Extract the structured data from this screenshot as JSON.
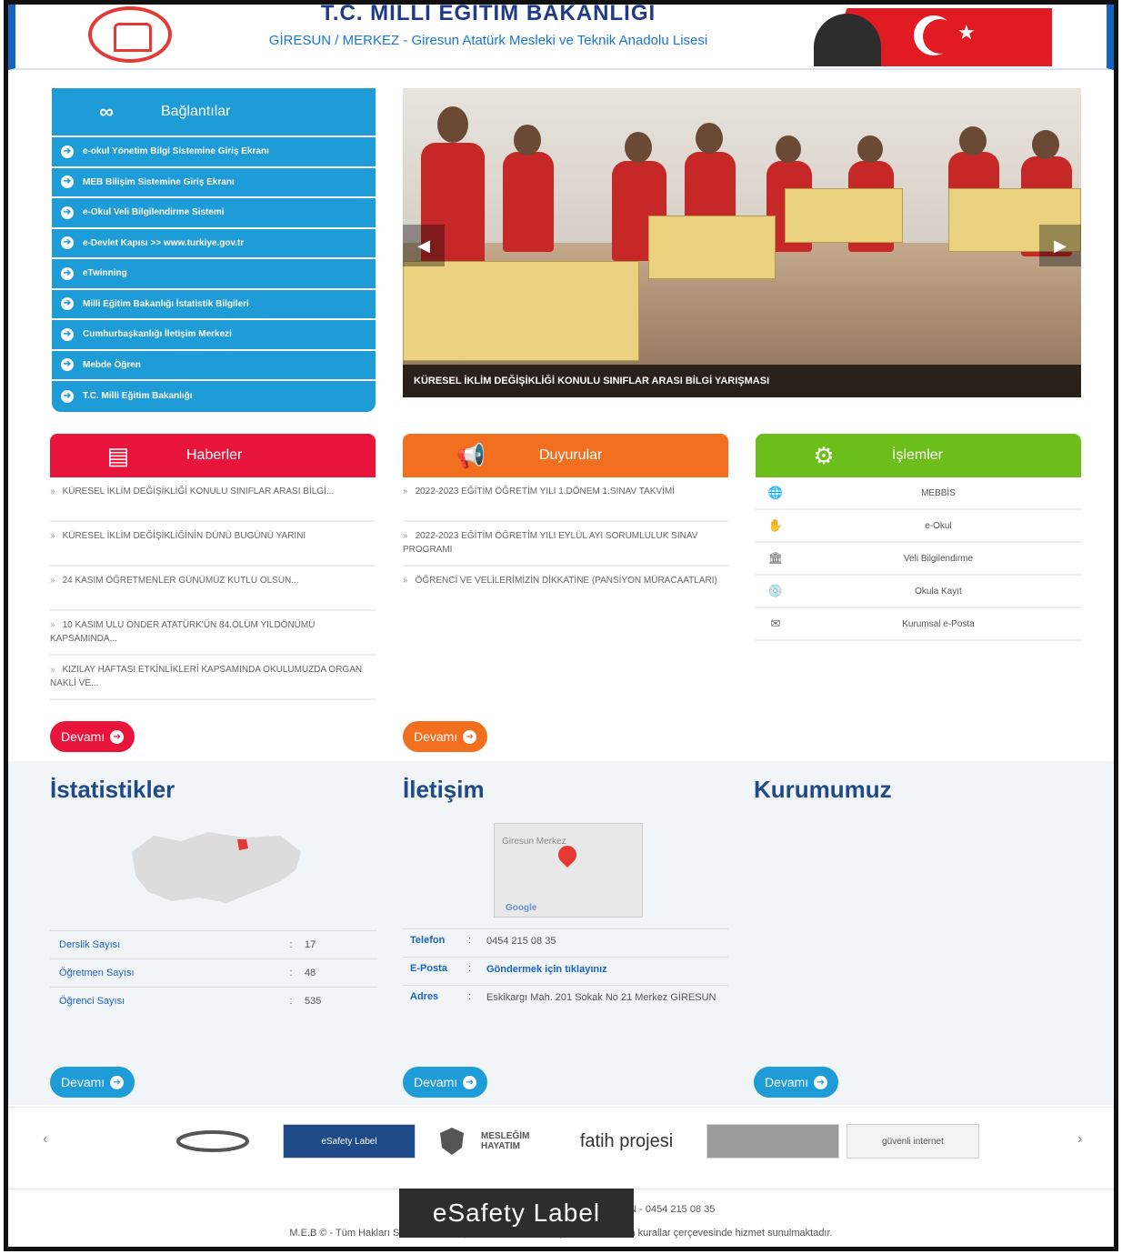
{
  "header": {
    "ministry": "T.C. MİLLİ EĞİTİM BAKANLIĞI",
    "school": "GİRESUN / MERKEZ - Giresun Atatürk Mesleki ve Teknik Anadolu Lisesi"
  },
  "links": {
    "title": "Bağlantılar",
    "items": [
      "e-okul Yönetim Bilgi Sistemine Giriş Ekranı",
      "MEB Bilişim Sistemine Giriş Ekranı",
      "e-Okul Veli Bilgilendirme Sistemi",
      "e-Devlet Kapısı >> www.turkiye.gov.tr",
      "eTwinning",
      "Milli Eğitim Bakanlığı İstatistik Bilgileri",
      "Cumhurbaşkanlığı İletişim Merkezi",
      "Mebde Öğren",
      "T.C. Milli Eğitim Bakanlığı"
    ]
  },
  "slider": {
    "caption": "KÜRESEL İKLİM DEĞİŞİKLİĞİ KONULU SINIFLAR ARASI BİLGİ YARIŞMASI",
    "prev_icon": "◀",
    "next_icon": "▶"
  },
  "news": {
    "title": "Haberler",
    "items": [
      "KÜRESEL İKLİM DEĞİŞİKLİĞİ KONULU SINIFLAR ARASI BİLGİ...",
      "KÜRESEL İKLİM DEĞİŞİKLİĞİNİN DÜNÜ BUGÜNÜ YARINI",
      "24 KASIM ÖĞRETMENLER GÜNÜMÜZ KUTLU OLSUN...",
      "10 KASIM ULU ÖNDER ATATÜRK'ÜN 84.ÖLÜM YILDÖNÜMÜ KAPSAMINDA...",
      "KIZILAY HAFTASI ETKİNLİKLERİ KAPSAMINDA OKULUMUZDA ORGAN NAKLİ VE..."
    ],
    "more": "Devamı"
  },
  "announcements": {
    "title": "Duyurular",
    "items": [
      "2022-2023 EĞİTİM ÖĞRETİM YILI 1.DÖNEM 1.SINAV TAKVİMİ",
      "2022-2023 EĞİTİM ÖĞRETİM YILI EYLÜL AYI SORUMLULUK SINAV PROGRAMI",
      "ÖĞRENCİ VE VELİLERİMİZİN DİKKATİNE (PANSİYON MÜRACAATLARI)"
    ],
    "more": "Devamı"
  },
  "operations": {
    "title": "İşlemler",
    "items": [
      {
        "label": "MEBBİS",
        "icon": "globe-icon"
      },
      {
        "label": "e-Okul",
        "icon": "hand-icon"
      },
      {
        "label": "Veli Bilgilendirme",
        "icon": "building-icon"
      },
      {
        "label": "Okula Kayıt",
        "icon": "disk-icon"
      },
      {
        "label": "Kurumsal e-Posta",
        "icon": "mail-icon"
      }
    ]
  },
  "stats": {
    "title": "İstatistikler",
    "rows": [
      {
        "k": "Derslik Sayısı",
        "s": ":",
        "v": "17"
      },
      {
        "k": "Öğretmen Sayısı",
        "s": ":",
        "v": "48"
      },
      {
        "k": "Öğrenci Sayısı",
        "s": ":",
        "v": "535"
      }
    ],
    "more": "Devamı"
  },
  "contact": {
    "title": "İletişim",
    "map_label": "Giresun Merkez",
    "map_brand": "Google",
    "rows": [
      {
        "k": "Telefon",
        "s": ":",
        "v": "0454 215 08 35"
      },
      {
        "k": "E-Posta",
        "s": ":",
        "v": "Göndermek için tıklayınız"
      },
      {
        "k": "Adres",
        "s": ":",
        "v": "Eskikargı Mah. 201 Sokak No 21 Merkez GİRESUN"
      }
    ],
    "more": "Devamı"
  },
  "institution": {
    "title": "Kurumumuz",
    "more": "Devamı"
  },
  "partners": {
    "items": [
      "",
      "eSafety Label",
      "",
      "MESLEĞİM HAYATIM",
      "fatih projesi",
      "",
      "güvenli internet"
    ]
  },
  "footer": {
    "line1": "Eskikargı Mah. 201 Sokak No 21 Merkez GİRESUN - 0454 215 08 35",
    "line2": "M.E.B © - Tüm Hakları Saklıdır. Gizlilik politikası ve kullanım şartları belirlenen kurallar çerçevesinde hizmet sunulmaktadır.",
    "tooltip": "eSafety Label"
  },
  "colors": {
    "links": "#1e9cd7",
    "news": "#e8143c",
    "announcements": "#f26f1f",
    "operations": "#6cbf1b",
    "stats_more": "#1e9cd7",
    "title": "#1e4a8a"
  }
}
